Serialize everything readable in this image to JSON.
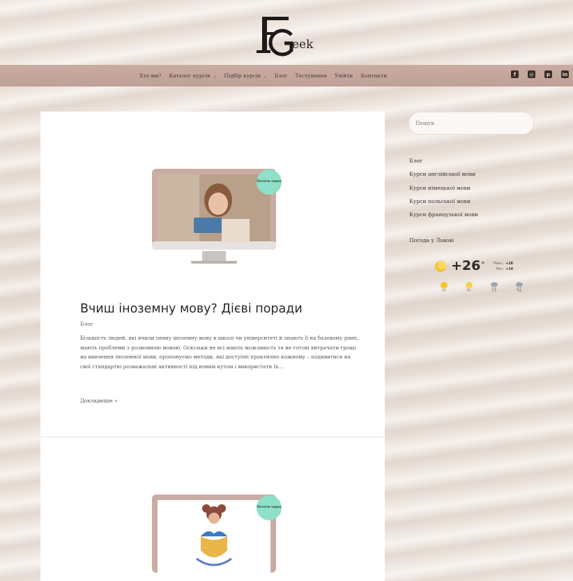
{
  "logo": {
    "letters": "FG",
    "text": "eek"
  },
  "nav": {
    "items": [
      {
        "label": "Хто ми?",
        "dropdown": false
      },
      {
        "label": "Каталог курсів",
        "dropdown": true
      },
      {
        "label": "Підбір курсів",
        "dropdown": true
      },
      {
        "label": "Блог",
        "dropdown": false
      },
      {
        "label": "Тестування",
        "dropdown": false
      },
      {
        "label": "Увійти",
        "dropdown": false
      },
      {
        "label": "Контакти",
        "dropdown": false
      }
    ],
    "social": [
      "facebook-icon",
      "instagram-icon",
      "pinterest-icon",
      "linkedin-icon"
    ]
  },
  "post": {
    "badge": "Почати зараз",
    "title": "Вчиш іноземну мову? Дієві поради",
    "category": "Блог",
    "excerpt": "Більшість людей, які вчили певну іноземну мову в школі чи університеті й знають її на базовому рівні, мають проблеми з розмовною мовою. Оскільки не всі мають можливість та не готові витрачати гроші на вивчення іноземної мови, пропонуємо методи, які доступні практично кожному – подивитися на свої стандартні розважальні активності під новим кутом і використати їх…",
    "read_more": "Докладніше »"
  },
  "post2": {
    "badge": "Почати зараз"
  },
  "sidebar": {
    "search_placeholder": "Пошук",
    "categories": [
      "Блог",
      "Курси англійської мови",
      "Курси німецької мови",
      "Курси польської мови",
      "Курси французької мови"
    ],
    "weather": {
      "title": "Погода у Львові",
      "temp": "+26",
      "unit": "°",
      "max_label": "Макс.:",
      "max_value": "+26",
      "min_label": "Мін.:",
      "min_value": "+14",
      "forecast": [
        {
          "day": "Чт",
          "icon": "sun-icon"
        },
        {
          "day": "Пт",
          "icon": "sun-icon"
        },
        {
          "day": "Сб",
          "icon": "cloud-rain-icon"
        },
        {
          "day": "Нд",
          "icon": "cloud-rain-icon"
        }
      ]
    }
  },
  "colors": {
    "nav_bg": "#c4a69c",
    "badge": "#8fe0c8",
    "panel": "#ffffff"
  }
}
